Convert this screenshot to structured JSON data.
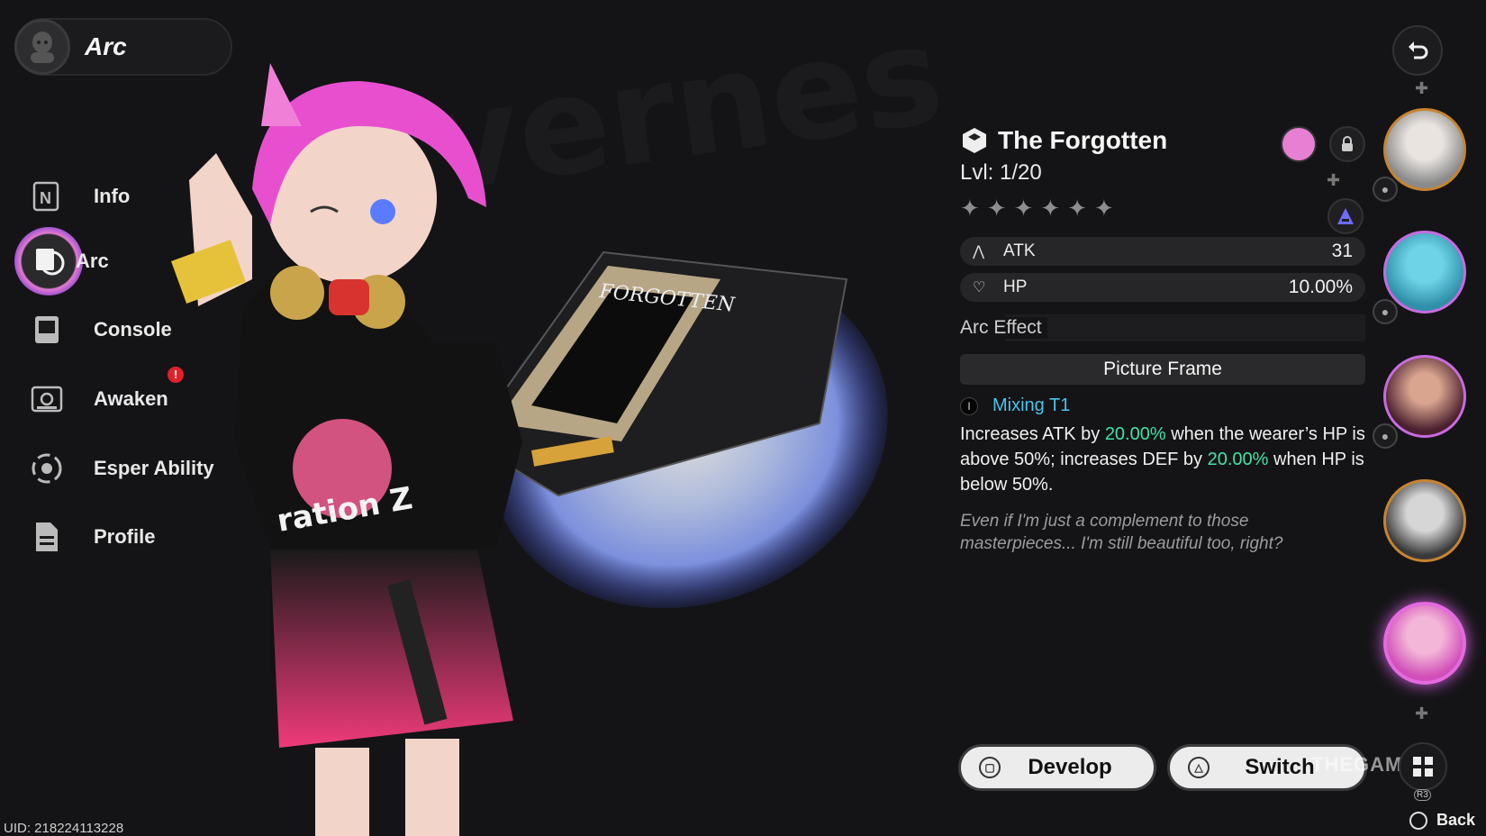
{
  "header": {
    "title": "Arc"
  },
  "nav": {
    "items": [
      {
        "label": "Info",
        "icon": "info-book-icon"
      },
      {
        "label": "Arc",
        "icon": "arc-record-icon",
        "active": true
      },
      {
        "label": "Console",
        "icon": "console-icon"
      },
      {
        "label": "Awaken",
        "icon": "awaken-photo-icon",
        "alert": "!"
      },
      {
        "label": "Esper Ability",
        "icon": "esper-swirl-icon"
      },
      {
        "label": "Profile",
        "icon": "profile-document-icon"
      }
    ]
  },
  "uid": "UID: 218224113228",
  "arc": {
    "name": "The Forgotten",
    "level": "Lvl: 1/20",
    "stars": 6,
    "stats": [
      {
        "name": "ATK",
        "value": "31",
        "icon": "atk-chevron-icon"
      },
      {
        "name": "HP",
        "value": "10.00%",
        "icon": "hp-heart-icon"
      }
    ],
    "effect_heading": "Arc Effect",
    "effect_name": "Picture Frame",
    "tier_numeral": "I",
    "tier_name": "Mixing T1",
    "desc": {
      "p1": "Increases ATK by ",
      "v1": "20.00%",
      "p2": " when the wearer’s HP is above 50%; increases DEF by ",
      "v2": "20.00%",
      "p3": " when HP is below 50%."
    },
    "flavor": "Even if I'm just a complement to those masterpieces... I'm still beautiful too, right?"
  },
  "art": {
    "record_title": "FORGOTTEN",
    "shirt_text": "ration Z"
  },
  "buttons": {
    "develop": "Develop",
    "switch": "Switch",
    "back": "Back",
    "r3": "R3"
  },
  "watermark": "THEGAMER",
  "colors": {
    "highlight": "#41e3a6",
    "tier": "#49c4ea",
    "active_ring": "#e37bd0",
    "alert": "#e0212b"
  }
}
